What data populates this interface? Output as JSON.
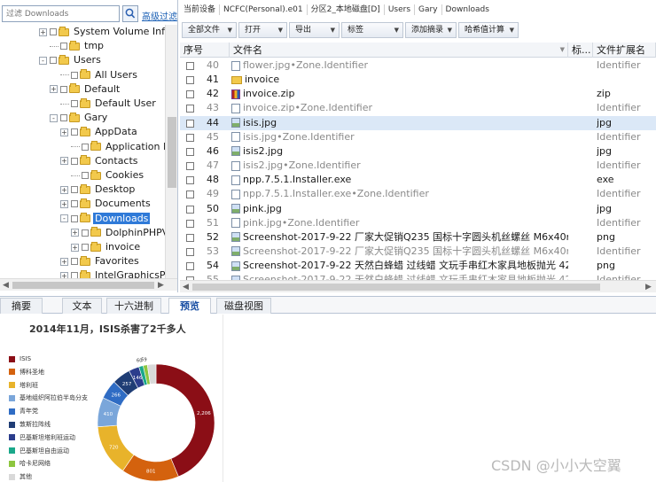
{
  "filter": {
    "placeholder": "过滤 Downloads",
    "advanced_label": "高级过滤"
  },
  "tree": [
    {
      "indent": 44,
      "expander": "+",
      "label": "System Volume Infor",
      "selected": false
    },
    {
      "indent": 56,
      "expander": "",
      "label": "tmp",
      "selected": false
    },
    {
      "indent": 44,
      "expander": "-",
      "label": "Users",
      "selected": false
    },
    {
      "indent": 68,
      "expander": "",
      "label": "All Users",
      "selected": false
    },
    {
      "indent": 56,
      "expander": "+",
      "label": "Default",
      "selected": false
    },
    {
      "indent": 68,
      "expander": "",
      "label": "Default User",
      "selected": false
    },
    {
      "indent": 56,
      "expander": "-",
      "label": "Gary",
      "selected": false
    },
    {
      "indent": 68,
      "expander": "+",
      "label": "AppData",
      "selected": false
    },
    {
      "indent": 80,
      "expander": "",
      "label": "Application Data",
      "selected": false
    },
    {
      "indent": 68,
      "expander": "+",
      "label": "Contacts",
      "selected": false
    },
    {
      "indent": 80,
      "expander": "",
      "label": "Cookies",
      "selected": false
    },
    {
      "indent": 68,
      "expander": "+",
      "label": "Desktop",
      "selected": false
    },
    {
      "indent": 68,
      "expander": "+",
      "label": "Documents",
      "selected": false
    },
    {
      "indent": 68,
      "expander": "-",
      "label": "Downloads",
      "selected": true
    },
    {
      "indent": 80,
      "expander": "+",
      "label": "DolphinPHPV",
      "selected": false
    },
    {
      "indent": 80,
      "expander": "+",
      "label": "invoice",
      "selected": false
    },
    {
      "indent": 68,
      "expander": "+",
      "label": "Favorites",
      "selected": false
    },
    {
      "indent": 68,
      "expander": "+",
      "label": "IntelGraphicsPro",
      "selected": false
    }
  ],
  "breadcrumb": [
    "当前设备",
    "NCFC(Personal).e01",
    "分区2_本地磁盘[D]",
    "Users",
    "Gary",
    "Downloads"
  ],
  "toolbar": [
    {
      "label": "全部文件",
      "caret": "▼"
    },
    {
      "label": "打开",
      "caret": "▼"
    },
    {
      "label": "导出",
      "caret": "▼"
    },
    {
      "label": "标签",
      "caret": "▼"
    },
    {
      "label": "添加摘录",
      "caret": "▼"
    },
    {
      "label": "哈希值计算",
      "caret": "▼"
    }
  ],
  "columns": {
    "no": "序号",
    "name": "文件名",
    "tag": "标...",
    "ext": "文件扩展名"
  },
  "files": [
    {
      "no": "40",
      "name": "flower.jpg•Zone.Identifier",
      "ext": "Identifier",
      "icon": "doc",
      "dim": true,
      "selected": false
    },
    {
      "no": "41",
      "name": "invoice",
      "ext": "",
      "icon": "fold",
      "dim": false,
      "selected": false
    },
    {
      "no": "42",
      "name": "invoice.zip",
      "ext": "zip",
      "icon": "zip",
      "dim": false,
      "selected": false
    },
    {
      "no": "43",
      "name": "invoice.zip•Zone.Identifier",
      "ext": "Identifier",
      "icon": "doc",
      "dim": true,
      "selected": false
    },
    {
      "no": "44",
      "name": "isis.jpg",
      "ext": "jpg",
      "icon": "img",
      "dim": false,
      "selected": true
    },
    {
      "no": "45",
      "name": "isis.jpg•Zone.Identifier",
      "ext": "Identifier",
      "icon": "doc",
      "dim": true,
      "selected": false
    },
    {
      "no": "46",
      "name": "isis2.jpg",
      "ext": "jpg",
      "icon": "img",
      "dim": false,
      "selected": false
    },
    {
      "no": "47",
      "name": "isis2.jpg•Zone.Identifier",
      "ext": "Identifier",
      "icon": "doc",
      "dim": true,
      "selected": false
    },
    {
      "no": "48",
      "name": "npp.7.5.1.Installer.exe",
      "ext": "exe",
      "icon": "doc",
      "dim": false,
      "selected": false
    },
    {
      "no": "49",
      "name": "npp.7.5.1.Installer.exe•Zone.Identifier",
      "ext": "Identifier",
      "icon": "doc",
      "dim": true,
      "selected": false
    },
    {
      "no": "50",
      "name": "pink.jpg",
      "ext": "jpg",
      "icon": "img",
      "dim": false,
      "selected": false
    },
    {
      "no": "51",
      "name": "pink.jpg•Zone.Identifier",
      "ext": "Identifier",
      "icon": "doc",
      "dim": true,
      "selected": false
    },
    {
      "no": "52",
      "name": "Screenshot-2017-9-22 厂家大促销Q235 国标十字圆头机丝螺丝 M6x40mm(...",
      "ext": "png",
      "icon": "img",
      "dim": false,
      "selected": false
    },
    {
      "no": "53",
      "name": "Screenshot-2017-9-22 厂家大促销Q235 国标十字圆头机丝螺丝 M6x40mm(...",
      "ext": "Identifier",
      "icon": "img",
      "dim": true,
      "selected": false
    },
    {
      "no": "54",
      "name": "Screenshot-2017-9-22 天然白蜂蜡 过线蜡 文玩手串红木家具地板抛光 42克...",
      "ext": "png",
      "icon": "img",
      "dim": false,
      "selected": false
    },
    {
      "no": "55",
      "name": "Screenshot-2017-9-22 天然白蜂蜡 过线蜡 文玩手串红木家具地板抛光 42克...",
      "ext": "Identifier",
      "icon": "img",
      "dim": true,
      "selected": false
    }
  ],
  "tabs": [
    {
      "label": "摘要",
      "active": false
    },
    {
      "label": "文本",
      "active": false
    },
    {
      "label": "十六进制",
      "active": false
    },
    {
      "label": "预览",
      "active": true
    },
    {
      "label": "磁盘视图",
      "active": false
    }
  ],
  "chart_data": {
    "type": "pie",
    "title": "2014年11月，ISIS杀害了2千多人",
    "donut": true,
    "legend_position": "left",
    "categories": [
      "ISIS",
      "博科圣地",
      "塔利班",
      "基地组织阿拉伯半岛分支",
      "青年党",
      "敦斯拉阵线",
      "巴基斯坦塔利班运动",
      "巴基斯坦自由运动",
      "哈卡尼网络",
      "其他"
    ],
    "values": [
      2206,
      801,
      720,
      410,
      266,
      257,
      146,
      60,
      59,
      120
    ],
    "colors": [
      "#8b0e16",
      "#d4620e",
      "#e8b32b",
      "#7aa6da",
      "#2f6cc4",
      "#1f3d75",
      "#2b3d8c",
      "#1aa88a",
      "#8dc63f",
      "#d9d9d9"
    ],
    "value_labels": [
      "2,206",
      "801",
      "720",
      "410",
      "266",
      "257",
      "146",
      "60",
      "59",
      ""
    ]
  },
  "watermark": "CSDN @小小大空翼"
}
